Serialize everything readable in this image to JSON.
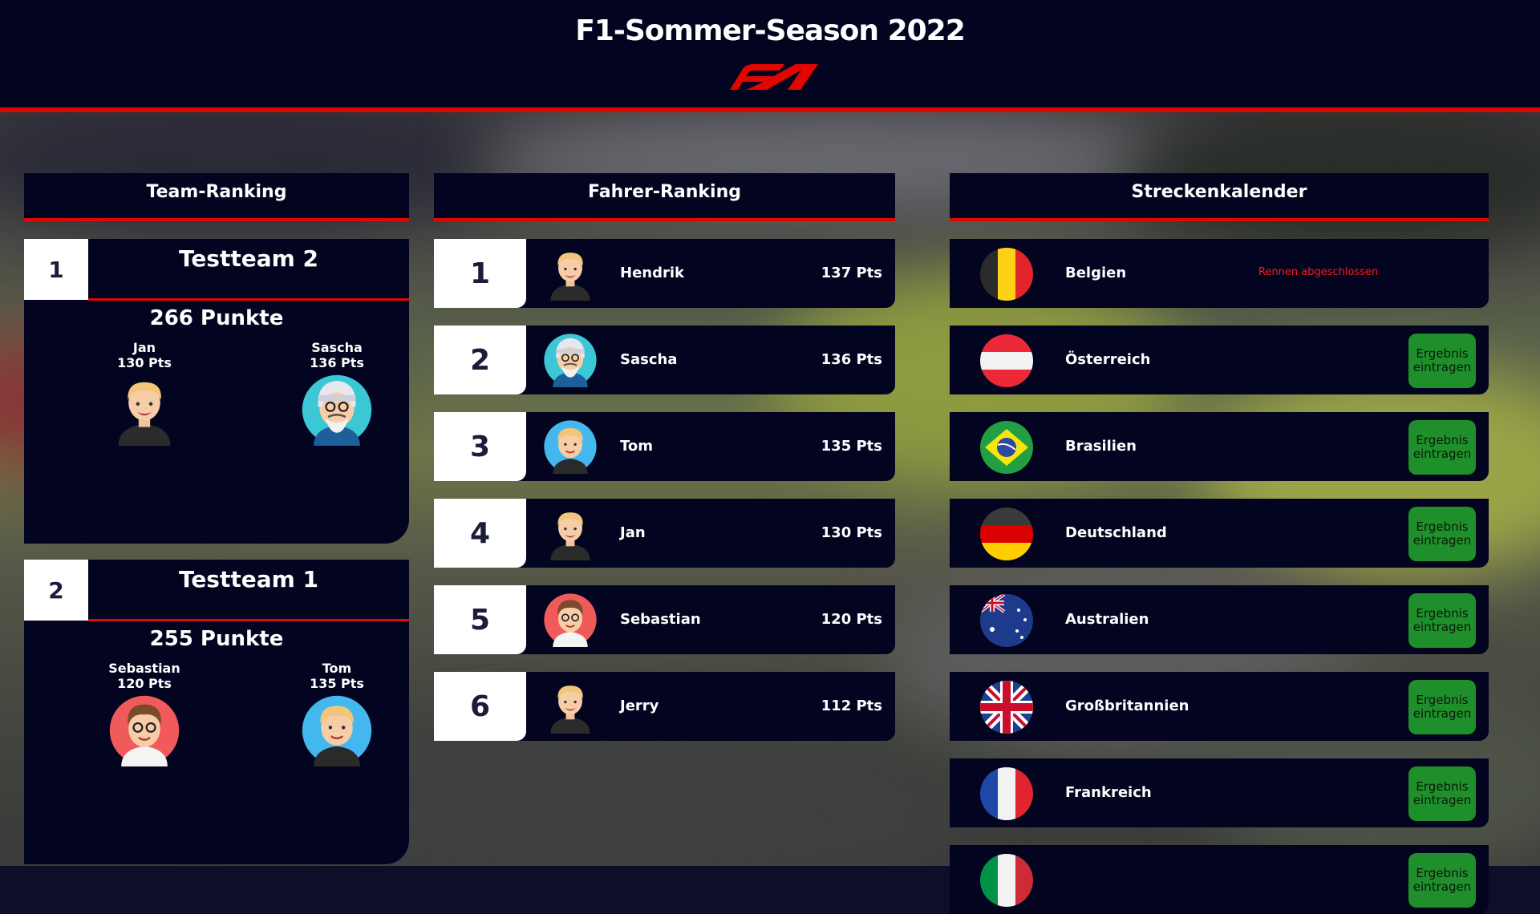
{
  "header": {
    "title": "F1-Sommer-Season 2022"
  },
  "sections": {
    "team_ranking": "Team-Ranking",
    "driver_ranking": "Fahrer-Ranking",
    "track_calendar": "Streckenkalender"
  },
  "teams": [
    {
      "rank": "1",
      "name": "Testteam 2",
      "points": "266 Punkte",
      "members": [
        {
          "name": "Jan",
          "points": "130 Pts"
        },
        {
          "name": "Sascha",
          "points": "136 Pts"
        }
      ]
    },
    {
      "rank": "2",
      "name": "Testteam 1",
      "points": "255 Punkte",
      "members": [
        {
          "name": "Sebastian",
          "points": "120 Pts"
        },
        {
          "name": "Tom",
          "points": "135 Pts"
        }
      ]
    }
  ],
  "drivers": [
    {
      "rank": "1",
      "name": "Hendrik",
      "points": "137 Pts"
    },
    {
      "rank": "2",
      "name": "Sascha",
      "points": "136 Pts"
    },
    {
      "rank": "3",
      "name": "Tom",
      "points": "135 Pts"
    },
    {
      "rank": "4",
      "name": "Jan",
      "points": "130 Pts"
    },
    {
      "rank": "5",
      "name": "Sebastian",
      "points": "120 Pts"
    },
    {
      "rank": "6",
      "name": "Jerry",
      "points": "112 Pts"
    }
  ],
  "tracks": [
    {
      "country": "Belgien",
      "status": "Rennen abgeschlossen"
    },
    {
      "country": "Österreich",
      "button": "Ergebnis eintragen"
    },
    {
      "country": "Brasilien",
      "button": "Ergebnis eintragen"
    },
    {
      "country": "Deutschland",
      "button": "Ergebnis eintragen"
    },
    {
      "country": "Australien",
      "button": "Ergebnis eintragen"
    },
    {
      "country": "Großbritannien",
      "button": "Ergebnis eintragen"
    },
    {
      "country": "Frankreich",
      "button": "Ergebnis eintragen"
    },
    {
      "country": "",
      "button": "Ergebnis eintragen"
    }
  ],
  "colors": {
    "accent_red": "#e10600",
    "panel": "#03041f",
    "button_green": "#1e8f2a"
  }
}
